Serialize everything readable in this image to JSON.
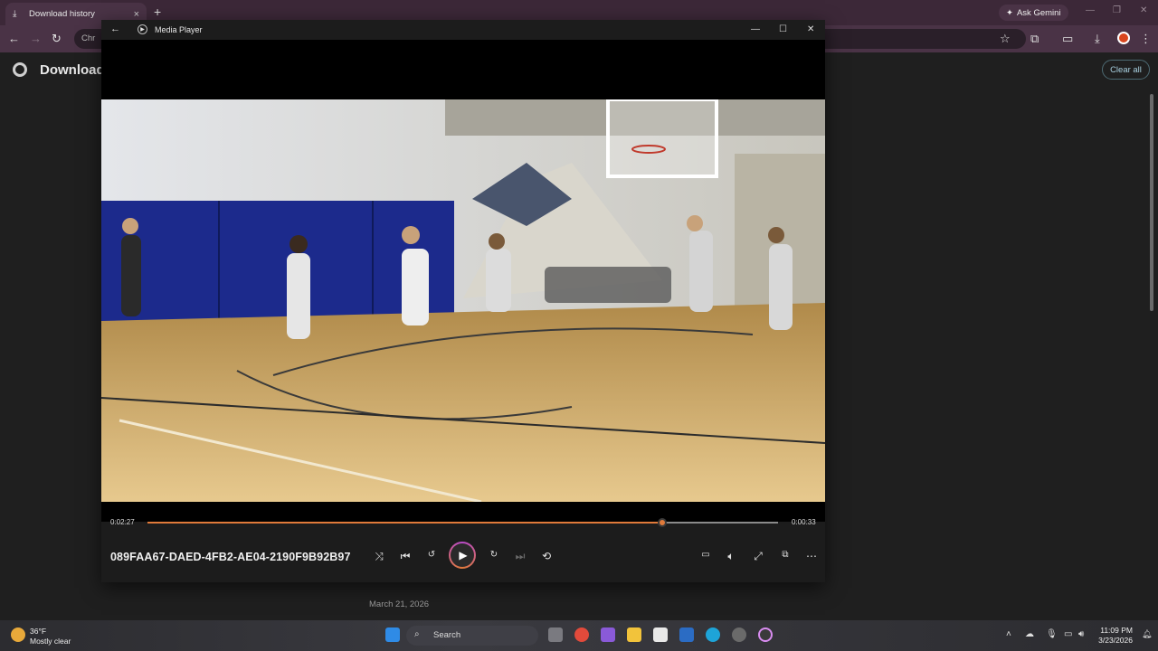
{
  "browser": {
    "tab_title": "Download history",
    "ask_gemini": "Ask Gemini",
    "omnibox_text": "Chr",
    "colors": {
      "tabbar": "#3c2838",
      "toolbar": "#4a3346"
    }
  },
  "downloads_page": {
    "title": "Download",
    "clear_all": "Clear all",
    "date_label": "March 21, 2026"
  },
  "media_player": {
    "app_name": "Media Player",
    "time_elapsed": "0:02:27",
    "time_remaining": "0:00:33",
    "progress": 0.817,
    "file_title": "089FAA67-DAED-4FB2-AE04-2190F9B92B97",
    "accent_color": "#e07a3a",
    "icons": [
      "shuffle-icon",
      "previous-icon",
      "rewind-10-icon",
      "play-icon",
      "forward-30-icon",
      "next-icon",
      "repeat-icon",
      "captions-icon",
      "volume-icon",
      "fullscreen-icon",
      "mini-player-icon",
      "more-icon"
    ]
  },
  "taskbar": {
    "weather_temp": "36°F",
    "weather_condition": "Mostly clear",
    "search_label": "Search",
    "time": "11:09 PM",
    "date": "3/23/2026"
  }
}
